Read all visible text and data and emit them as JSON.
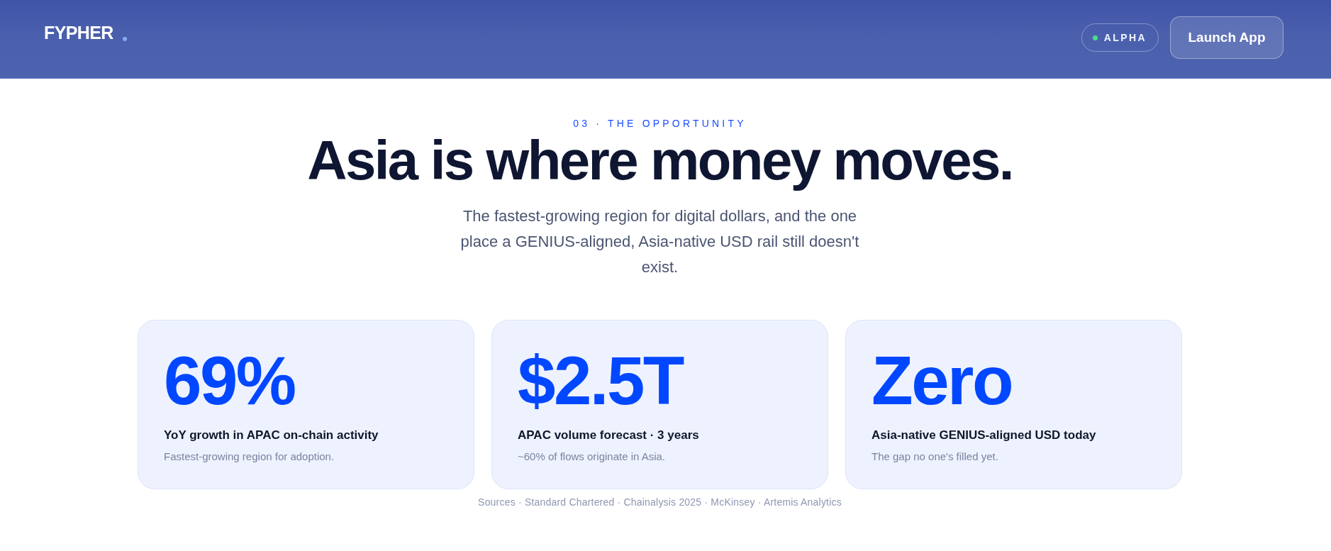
{
  "header": {
    "logo": "FYPHER",
    "badge": "ALPHA",
    "button": "Launch App"
  },
  "hero": {
    "eyebrow": "03 · THE OPPORTUNITY",
    "title": "Asia is where money moves.",
    "subtitle": "The fastest-growing region for digital dollars, and the one place a GENIUS-aligned, Asia-native USD rail still doesn't exist."
  },
  "stats": [
    {
      "value": "69%",
      "label": "YoY growth in APAC on-chain activity",
      "note": "Fastest-growing region for adoption."
    },
    {
      "value": "$2.5T",
      "label": "APAC volume forecast · 3 years",
      "note": "~60% of flows originate in Asia."
    },
    {
      "value": "Zero",
      "label": "Asia-native GENIUS-aligned USD today",
      "note": "The gap no one's filled yet."
    }
  ],
  "sources": "Sources · Standard Chartered · Chainalysis 2025 · McKinsey · Artemis Analytics"
}
